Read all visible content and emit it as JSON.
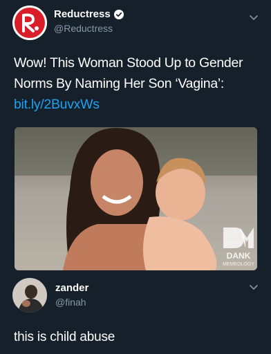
{
  "tweet": {
    "display_name": "Reductress",
    "handle": "@Reductress",
    "text": "Wow! This Woman Stood Up to Gender Norms By Naming Her Son ‘Vagina’:",
    "link": "bit.ly/2BuvxWs",
    "avatar_icon": "reductress-logo-icon",
    "verified_icon": "verified-badge-icon",
    "media": {
      "watermark_icon": "dankmemeology-watermark-icon",
      "watermark_text": [
        "DANK",
        "MEMEOLOGY"
      ]
    }
  },
  "reply": {
    "display_name": "zander",
    "handle": "@finah",
    "text": "this is child abuse"
  },
  "colors": {
    "background": "#15202b",
    "text": "#ffffff",
    "secondary_text": "#8899a6",
    "link": "#1da1f2",
    "logo_red": "#d91e2a"
  }
}
